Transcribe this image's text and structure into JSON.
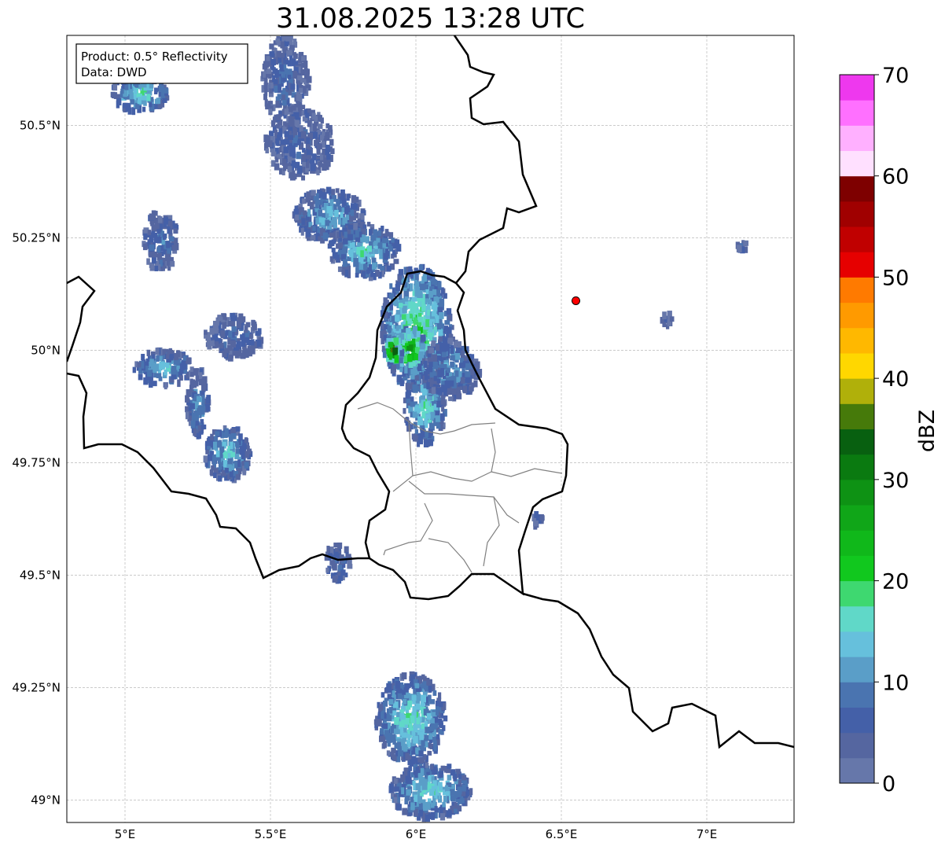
{
  "title": "31.08.2025 13:28 UTC",
  "info_box": {
    "line1": "Product: 0.5° Reflectivity",
    "line2": "Data: DWD"
  },
  "map": {
    "lon_range": [
      4.8,
      7.3
    ],
    "lat_range": [
      48.95,
      50.7
    ],
    "lon_ticks": [
      {
        "value": 5.0,
        "label": "5°E"
      },
      {
        "value": 5.5,
        "label": "5.5°E"
      },
      {
        "value": 6.0,
        "label": "6°E"
      },
      {
        "value": 6.5,
        "label": "6.5°E"
      },
      {
        "value": 7.0,
        "label": "7°E"
      }
    ],
    "lat_ticks": [
      {
        "value": 50.5,
        "label": "50.5°N"
      },
      {
        "value": 50.25,
        "label": "50.25°N"
      },
      {
        "value": 50.0,
        "label": "50°N"
      },
      {
        "value": 49.75,
        "label": "49.75°N"
      },
      {
        "value": 49.5,
        "label": "49.5°N"
      },
      {
        "value": 49.25,
        "label": "49.25°N"
      },
      {
        "value": 49.0,
        "label": "49°N"
      }
    ],
    "marker": {
      "lon": 6.55,
      "lat": 50.11,
      "color": "#ff0000"
    },
    "border_color": "#000000",
    "admin_border_color": "#808080",
    "grid": true
  },
  "colorbar": {
    "label": "dBZ",
    "min": 0,
    "max": 70,
    "step": 2.5,
    "tick_labels": [
      "0",
      "10",
      "20",
      "30",
      "40",
      "50",
      "60",
      "70"
    ],
    "tick_values": [
      0,
      10,
      20,
      30,
      40,
      50,
      60,
      70
    ],
    "colors": [
      "#6677aa",
      "#5566a0",
      "#4460a8",
      "#4a74b0",
      "#5a9ec8",
      "#66c0dc",
      "#60d8c8",
      "#3ed870",
      "#11c81e",
      "#10b81a",
      "#10a618",
      "#0e9214",
      "#0a7a10",
      "#086010",
      "#467a0a",
      "#b0b00a",
      "#ffd700",
      "#ffb800",
      "#ff9a00",
      "#ff7a00",
      "#e60000",
      "#c00000",
      "#a00000",
      "#7e0000",
      "#ffe0ff",
      "#ffb0ff",
      "#ff70ff",
      "#ee38ee"
    ]
  },
  "radar_blobs": [
    {
      "lon": 5.55,
      "lat": 50.6,
      "rx": 0.08,
      "ry": 0.1,
      "dbz": 8
    },
    {
      "lon": 5.05,
      "lat": 50.57,
      "rx": 0.1,
      "ry": 0.04,
      "dbz": 18
    },
    {
      "lon": 5.6,
      "lat": 50.46,
      "rx": 0.12,
      "ry": 0.08,
      "dbz": 7
    },
    {
      "lon": 5.7,
      "lat": 50.3,
      "rx": 0.12,
      "ry": 0.06,
      "dbz": 14
    },
    {
      "lon": 5.82,
      "lat": 50.22,
      "rx": 0.12,
      "ry": 0.06,
      "dbz": 16
    },
    {
      "lon": 5.12,
      "lat": 50.24,
      "rx": 0.06,
      "ry": 0.07,
      "dbz": 10
    },
    {
      "lon": 5.37,
      "lat": 50.03,
      "rx": 0.1,
      "ry": 0.05,
      "dbz": 8
    },
    {
      "lon": 5.13,
      "lat": 49.96,
      "rx": 0.1,
      "ry": 0.04,
      "dbz": 15
    },
    {
      "lon": 5.25,
      "lat": 49.88,
      "rx": 0.04,
      "ry": 0.08,
      "dbz": 12
    },
    {
      "lon": 5.35,
      "lat": 49.77,
      "rx": 0.08,
      "ry": 0.06,
      "dbz": 16
    },
    {
      "lon": 6.0,
      "lat": 50.05,
      "rx": 0.12,
      "ry": 0.14,
      "dbz": 22
    },
    {
      "lon": 5.98,
      "lat": 50.0,
      "rx": 0.05,
      "ry": 0.05,
      "dbz": 31
    },
    {
      "lon": 5.92,
      "lat": 50.0,
      "rx": 0.03,
      "ry": 0.03,
      "dbz": 40
    },
    {
      "lon": 6.03,
      "lat": 49.87,
      "rx": 0.07,
      "ry": 0.08,
      "dbz": 18
    },
    {
      "lon": 6.12,
      "lat": 49.96,
      "rx": 0.1,
      "ry": 0.07,
      "dbz": 12
    },
    {
      "lon": 5.73,
      "lat": 49.53,
      "rx": 0.04,
      "ry": 0.05,
      "dbz": 8
    },
    {
      "lon": 5.98,
      "lat": 49.18,
      "rx": 0.12,
      "ry": 0.1,
      "dbz": 18
    },
    {
      "lon": 6.05,
      "lat": 49.02,
      "rx": 0.14,
      "ry": 0.06,
      "dbz": 17
    },
    {
      "lon": 6.86,
      "lat": 50.07,
      "rx": 0.02,
      "ry": 0.02,
      "dbz": 7
    },
    {
      "lon": 7.12,
      "lat": 50.23,
      "rx": 0.02,
      "ry": 0.01,
      "dbz": 7
    },
    {
      "lon": 6.42,
      "lat": 49.62,
      "rx": 0.02,
      "ry": 0.02,
      "dbz": 8
    }
  ]
}
